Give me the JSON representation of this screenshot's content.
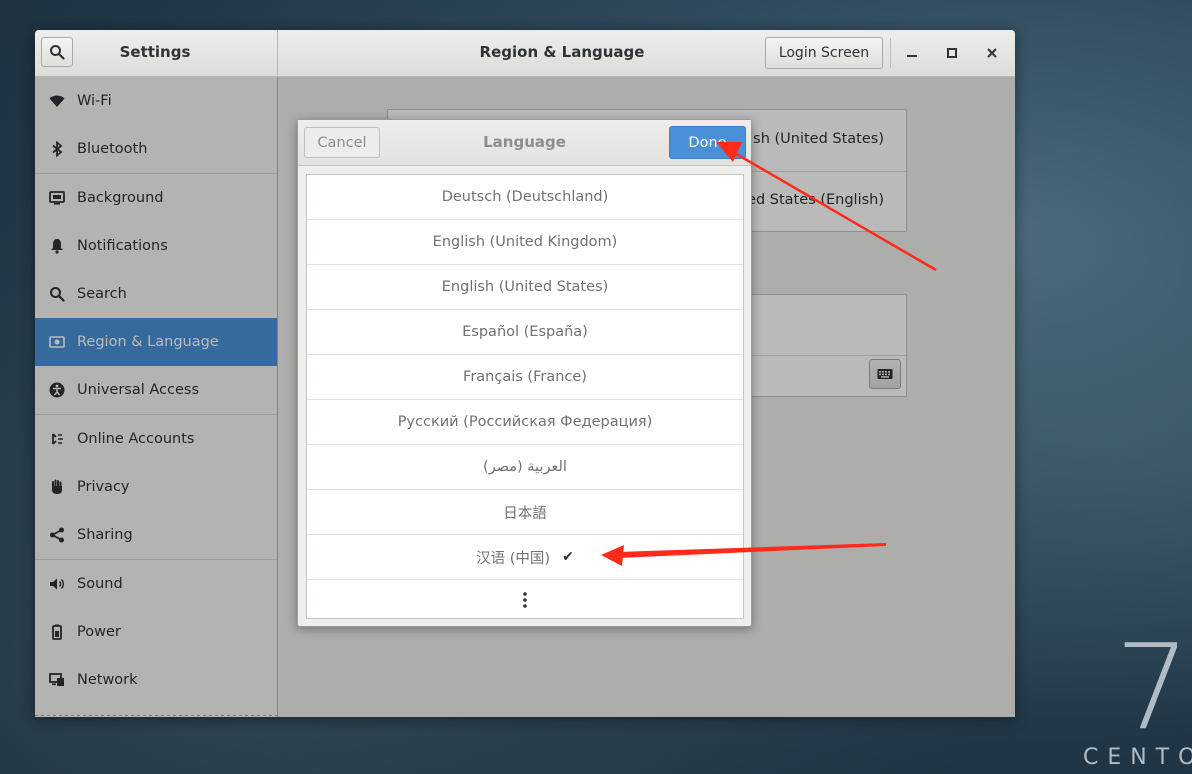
{
  "desktop": {
    "brand_number": "7",
    "brand_word": "CENTO"
  },
  "window": {
    "sidebar_title": "Settings",
    "panel_title": "Region & Language",
    "login_screen_label": "Login Screen",
    "controls": {
      "minimize": "−",
      "maximize": "□",
      "close": "✕"
    }
  },
  "sidebar": {
    "items": [
      {
        "label": "Wi-Fi",
        "icon": "wifi-icon"
      },
      {
        "label": "Bluetooth",
        "icon": "bluetooth-icon"
      },
      {
        "label": "Background",
        "icon": "background-icon"
      },
      {
        "label": "Notifications",
        "icon": "bell-icon"
      },
      {
        "label": "Search",
        "icon": "search-icon"
      },
      {
        "label": "Region & Language",
        "icon": "flag-icon",
        "active": true
      },
      {
        "label": "Universal Access",
        "icon": "accessibility-icon"
      },
      {
        "label": "Online Accounts",
        "icon": "online-accounts-icon"
      },
      {
        "label": "Privacy",
        "icon": "hand-icon"
      },
      {
        "label": "Sharing",
        "icon": "share-icon"
      },
      {
        "label": "Sound",
        "icon": "speaker-icon"
      },
      {
        "label": "Power",
        "icon": "power-icon"
      },
      {
        "label": "Network",
        "icon": "network-icon"
      }
    ]
  },
  "main": {
    "language_value_partial": "glish (United States)",
    "formats_value_partial": "nited States (English)"
  },
  "dialog": {
    "title": "Language",
    "cancel_label": "Cancel",
    "done_label": "Done",
    "languages": [
      {
        "label": "Deutsch (Deutschland)"
      },
      {
        "label": "English (United Kingdom)"
      },
      {
        "label": "English (United States)"
      },
      {
        "label": "Español (España)"
      },
      {
        "label": "Français (France)"
      },
      {
        "label": "Русский (Российская Федерация)"
      },
      {
        "label": "العربية (مصر)"
      },
      {
        "label": "日本語"
      },
      {
        "label": "汉语 (中国)",
        "selected": true,
        "check": "✔"
      }
    ],
    "more_label": "⋮"
  },
  "annotations": {
    "arrow_color": "#ff2a1a"
  },
  "colors": {
    "accent": "#4a90d9",
    "arrow": "#ff2a1a"
  }
}
